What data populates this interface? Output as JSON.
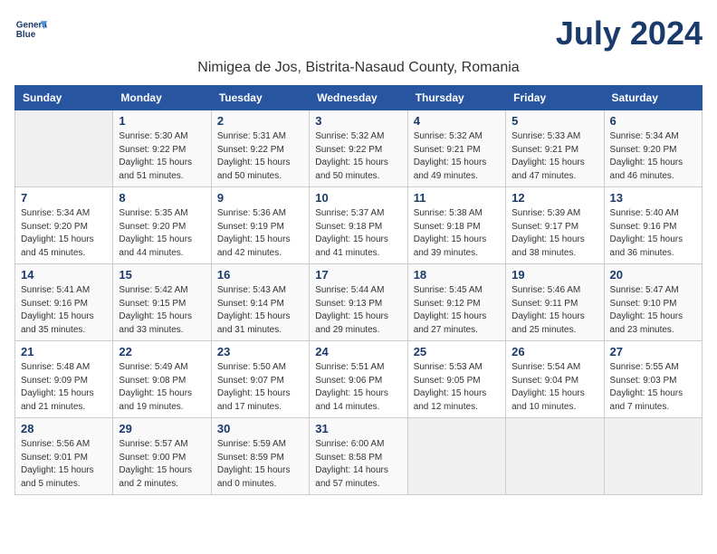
{
  "logo": {
    "line1": "General",
    "line2": "Blue"
  },
  "header": {
    "month": "July 2024",
    "location": "Nimigea de Jos, Bistrita-Nasaud County, Romania"
  },
  "weekdays": [
    "Sunday",
    "Monday",
    "Tuesday",
    "Wednesday",
    "Thursday",
    "Friday",
    "Saturday"
  ],
  "weeks": [
    [
      {
        "day": "",
        "info": ""
      },
      {
        "day": "1",
        "info": "Sunrise: 5:30 AM\nSunset: 9:22 PM\nDaylight: 15 hours\nand 51 minutes."
      },
      {
        "day": "2",
        "info": "Sunrise: 5:31 AM\nSunset: 9:22 PM\nDaylight: 15 hours\nand 50 minutes."
      },
      {
        "day": "3",
        "info": "Sunrise: 5:32 AM\nSunset: 9:22 PM\nDaylight: 15 hours\nand 50 minutes."
      },
      {
        "day": "4",
        "info": "Sunrise: 5:32 AM\nSunset: 9:21 PM\nDaylight: 15 hours\nand 49 minutes."
      },
      {
        "day": "5",
        "info": "Sunrise: 5:33 AM\nSunset: 9:21 PM\nDaylight: 15 hours\nand 47 minutes."
      },
      {
        "day": "6",
        "info": "Sunrise: 5:34 AM\nSunset: 9:20 PM\nDaylight: 15 hours\nand 46 minutes."
      }
    ],
    [
      {
        "day": "7",
        "info": "Sunrise: 5:34 AM\nSunset: 9:20 PM\nDaylight: 15 hours\nand 45 minutes."
      },
      {
        "day": "8",
        "info": "Sunrise: 5:35 AM\nSunset: 9:20 PM\nDaylight: 15 hours\nand 44 minutes."
      },
      {
        "day": "9",
        "info": "Sunrise: 5:36 AM\nSunset: 9:19 PM\nDaylight: 15 hours\nand 42 minutes."
      },
      {
        "day": "10",
        "info": "Sunrise: 5:37 AM\nSunset: 9:18 PM\nDaylight: 15 hours\nand 41 minutes."
      },
      {
        "day": "11",
        "info": "Sunrise: 5:38 AM\nSunset: 9:18 PM\nDaylight: 15 hours\nand 39 minutes."
      },
      {
        "day": "12",
        "info": "Sunrise: 5:39 AM\nSunset: 9:17 PM\nDaylight: 15 hours\nand 38 minutes."
      },
      {
        "day": "13",
        "info": "Sunrise: 5:40 AM\nSunset: 9:16 PM\nDaylight: 15 hours\nand 36 minutes."
      }
    ],
    [
      {
        "day": "14",
        "info": "Sunrise: 5:41 AM\nSunset: 9:16 PM\nDaylight: 15 hours\nand 35 minutes."
      },
      {
        "day": "15",
        "info": "Sunrise: 5:42 AM\nSunset: 9:15 PM\nDaylight: 15 hours\nand 33 minutes."
      },
      {
        "day": "16",
        "info": "Sunrise: 5:43 AM\nSunset: 9:14 PM\nDaylight: 15 hours\nand 31 minutes."
      },
      {
        "day": "17",
        "info": "Sunrise: 5:44 AM\nSunset: 9:13 PM\nDaylight: 15 hours\nand 29 minutes."
      },
      {
        "day": "18",
        "info": "Sunrise: 5:45 AM\nSunset: 9:12 PM\nDaylight: 15 hours\nand 27 minutes."
      },
      {
        "day": "19",
        "info": "Sunrise: 5:46 AM\nSunset: 9:11 PM\nDaylight: 15 hours\nand 25 minutes."
      },
      {
        "day": "20",
        "info": "Sunrise: 5:47 AM\nSunset: 9:10 PM\nDaylight: 15 hours\nand 23 minutes."
      }
    ],
    [
      {
        "day": "21",
        "info": "Sunrise: 5:48 AM\nSunset: 9:09 PM\nDaylight: 15 hours\nand 21 minutes."
      },
      {
        "day": "22",
        "info": "Sunrise: 5:49 AM\nSunset: 9:08 PM\nDaylight: 15 hours\nand 19 minutes."
      },
      {
        "day": "23",
        "info": "Sunrise: 5:50 AM\nSunset: 9:07 PM\nDaylight: 15 hours\nand 17 minutes."
      },
      {
        "day": "24",
        "info": "Sunrise: 5:51 AM\nSunset: 9:06 PM\nDaylight: 15 hours\nand 14 minutes."
      },
      {
        "day": "25",
        "info": "Sunrise: 5:53 AM\nSunset: 9:05 PM\nDaylight: 15 hours\nand 12 minutes."
      },
      {
        "day": "26",
        "info": "Sunrise: 5:54 AM\nSunset: 9:04 PM\nDaylight: 15 hours\nand 10 minutes."
      },
      {
        "day": "27",
        "info": "Sunrise: 5:55 AM\nSunset: 9:03 PM\nDaylight: 15 hours\nand 7 minutes."
      }
    ],
    [
      {
        "day": "28",
        "info": "Sunrise: 5:56 AM\nSunset: 9:01 PM\nDaylight: 15 hours\nand 5 minutes."
      },
      {
        "day": "29",
        "info": "Sunrise: 5:57 AM\nSunset: 9:00 PM\nDaylight: 15 hours\nand 2 minutes."
      },
      {
        "day": "30",
        "info": "Sunrise: 5:59 AM\nSunset: 8:59 PM\nDaylight: 15 hours\nand 0 minutes."
      },
      {
        "day": "31",
        "info": "Sunrise: 6:00 AM\nSunset: 8:58 PM\nDaylight: 14 hours\nand 57 minutes."
      },
      {
        "day": "",
        "info": ""
      },
      {
        "day": "",
        "info": ""
      },
      {
        "day": "",
        "info": ""
      }
    ]
  ]
}
